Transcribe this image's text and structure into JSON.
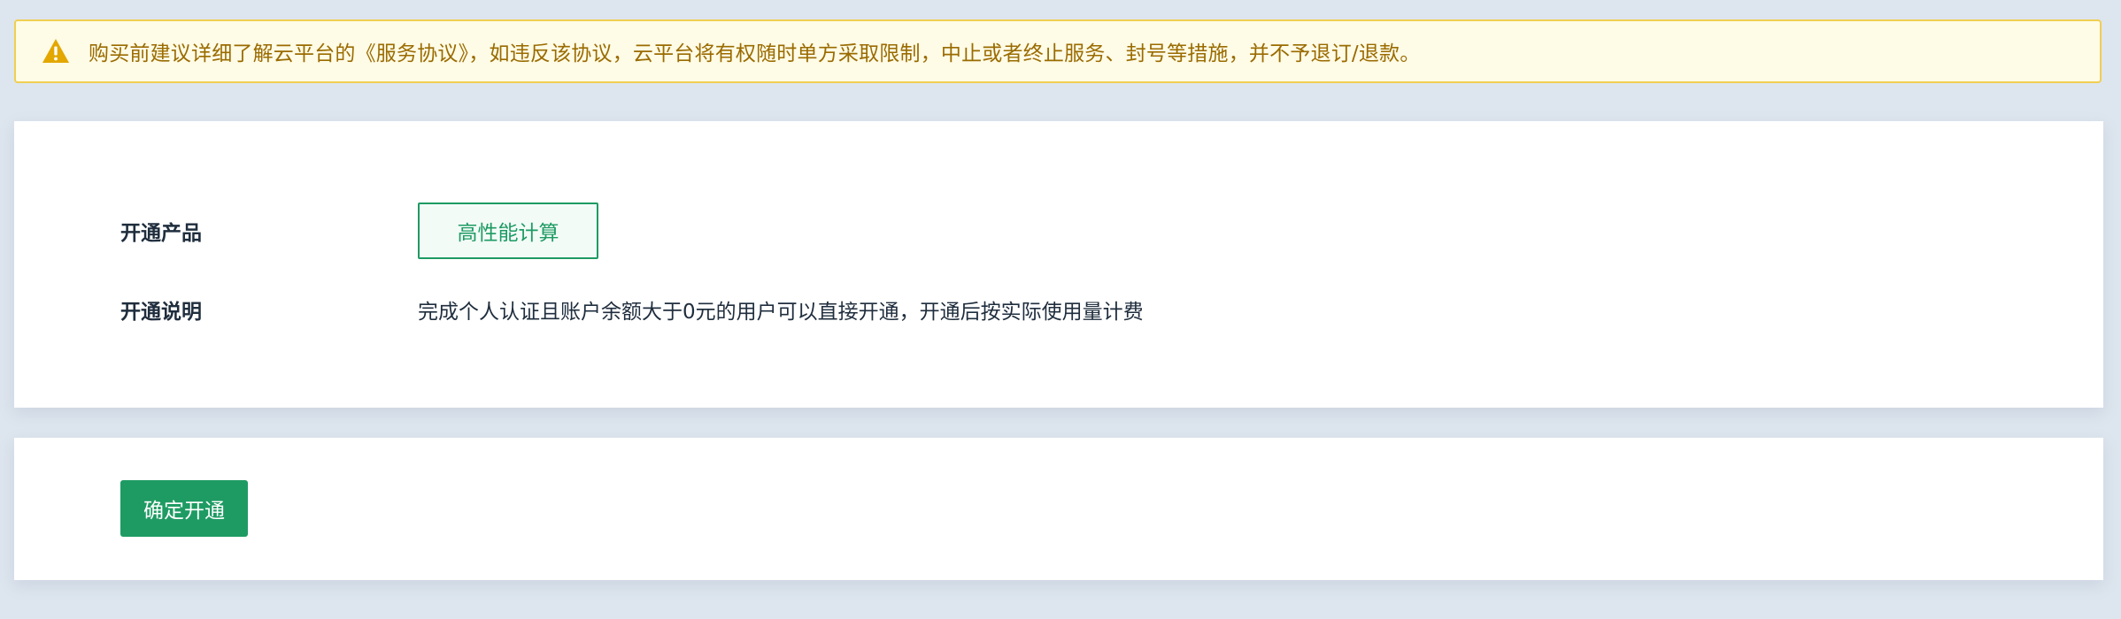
{
  "notice": {
    "icon": "warning-icon",
    "text": "购买前建议详细了解云平台的《服务协议》，如违反该协议，云平台将有权随时单方采取限制，中止或者终止服务、封号等措施，并不予退订/退款。",
    "colors": {
      "background": "#fefbe6",
      "border": "#f0cf52",
      "text": "#9a6b00",
      "icon": "#e3a700"
    }
  },
  "info": {
    "product_label": "开通产品",
    "product_value": "高性能计算",
    "desc_label": "开通说明",
    "desc_value": "完成个人认证且账户余额大于0元的用户可以直接开通，开通后按实际使用量计费"
  },
  "actions": {
    "confirm_label": "确定开通"
  },
  "colors": {
    "page_background": "#dde5ee",
    "accent": "#1e9b63"
  }
}
